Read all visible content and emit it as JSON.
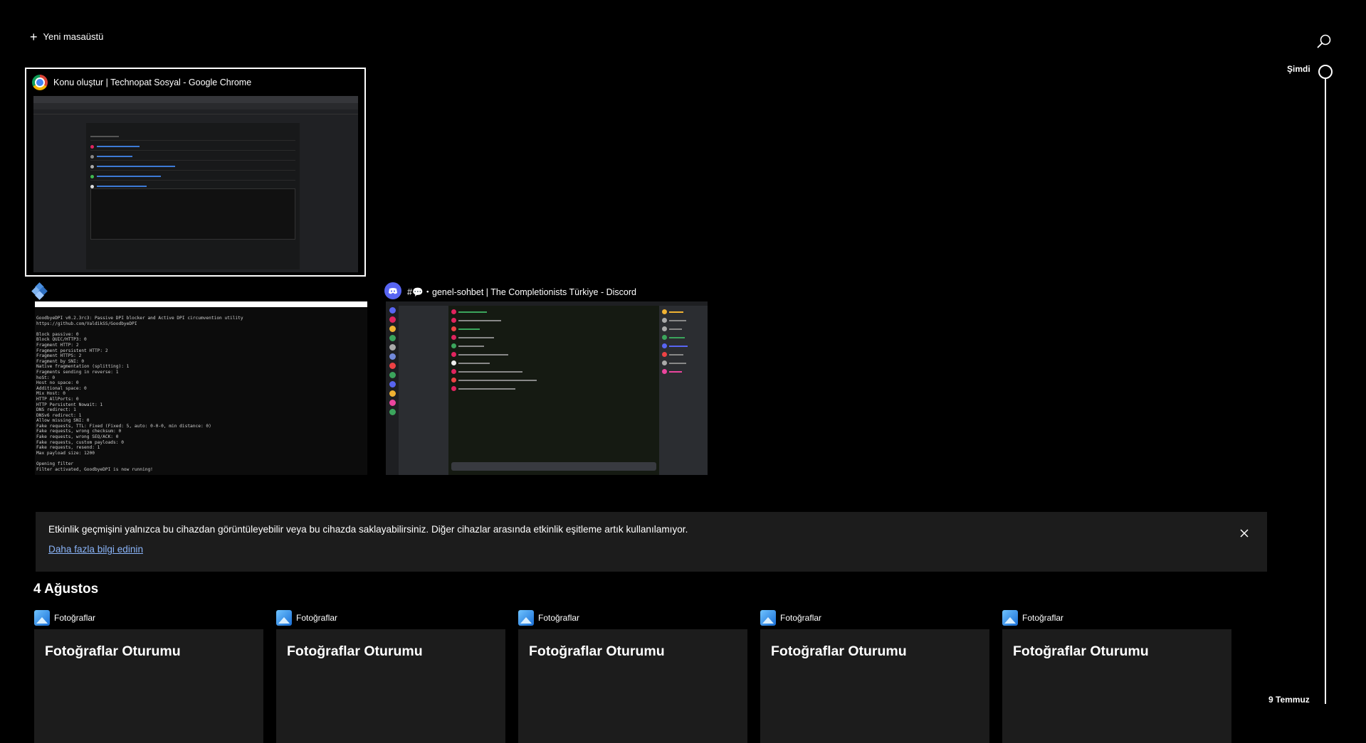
{
  "toolbar": {
    "new_desktop_label": "Yeni masaüstü"
  },
  "timeline": {
    "now_label": "Şimdi",
    "date_label": "9 Temmuz"
  },
  "windows": [
    {
      "title": "Konu oluştur | Technopat Sosyal - Google Chrome",
      "icon": "chrome-icon"
    },
    {
      "title": "",
      "icon": "goodbyedpi-icon",
      "console_lines": [
        "GoodbyeDPI v0.2.3rc3: Passive DPI blocker and Active DPI circumvention utility",
        "https://github.com/ValdikSS/GoodbyeDPI",
        "",
        "Block passive: 0",
        "Block QUIC/HTTP3: 0",
        "Fragment HTTP: 2",
        "Fragment persistent HTTP: 2",
        "Fragment HTTPS: 2",
        "Fragment by SNI: 0",
        "Native fragmentation (splitting): 1",
        "Fragments sending in reverse: 1",
        "hoSt: 0",
        "Host no space: 0",
        "Additional space: 0",
        "Mix Host: 0",
        "HTTP AllPorts: 0",
        "HTTP Persistent Nowait: 1",
        "DNS redirect: 1",
        "DNSv6 redirect: 1",
        "Allow missing SNI: 0",
        "Fake requests, TTL: Fixed (Fixed: 5, auto: 0-0-0, min distance: 0)",
        "Fake requests, wrong checksum: 0",
        "Fake requests, wrong SEQ/ACK: 0",
        "Fake requests, custom payloads: 0",
        "Fake requests, resend: 1",
        "Max payload size: 1200",
        "",
        "Opening filter",
        "Filter activated, GoodbyeDPI is now running!"
      ]
    },
    {
      "title": "#💬・genel-sohbet | The Completionists Türkiye - Discord",
      "icon": "discord-icon"
    }
  ],
  "notice": {
    "text": "Etkinlik geçmişini yalnızca bu cihazdan görüntüleyebilir veya bu cihazda saklayabilirsiniz. Diğer cihazlar arasında etkinlik eşitleme artık kullanılamıyor.",
    "link": "Daha fazla bilgi edinin"
  },
  "day_heading": "4 Ağustos",
  "activities": [
    {
      "app": "Fotoğraflar",
      "title": "Fotoğraflar Oturumu"
    },
    {
      "app": "Fotoğraflar",
      "title": "Fotoğraflar Oturumu"
    },
    {
      "app": "Fotoğraflar",
      "title": "Fotoğraflar Oturumu"
    },
    {
      "app": "Fotoğraflar",
      "title": "Fotoğraflar Oturumu"
    },
    {
      "app": "Fotoğraflar",
      "title": "Fotoğraflar Oturumu"
    }
  ],
  "colors": {
    "background": "#000000",
    "card": "#1c1c1c",
    "link": "#8ab4f8",
    "selected_outline": "#ffffff"
  }
}
